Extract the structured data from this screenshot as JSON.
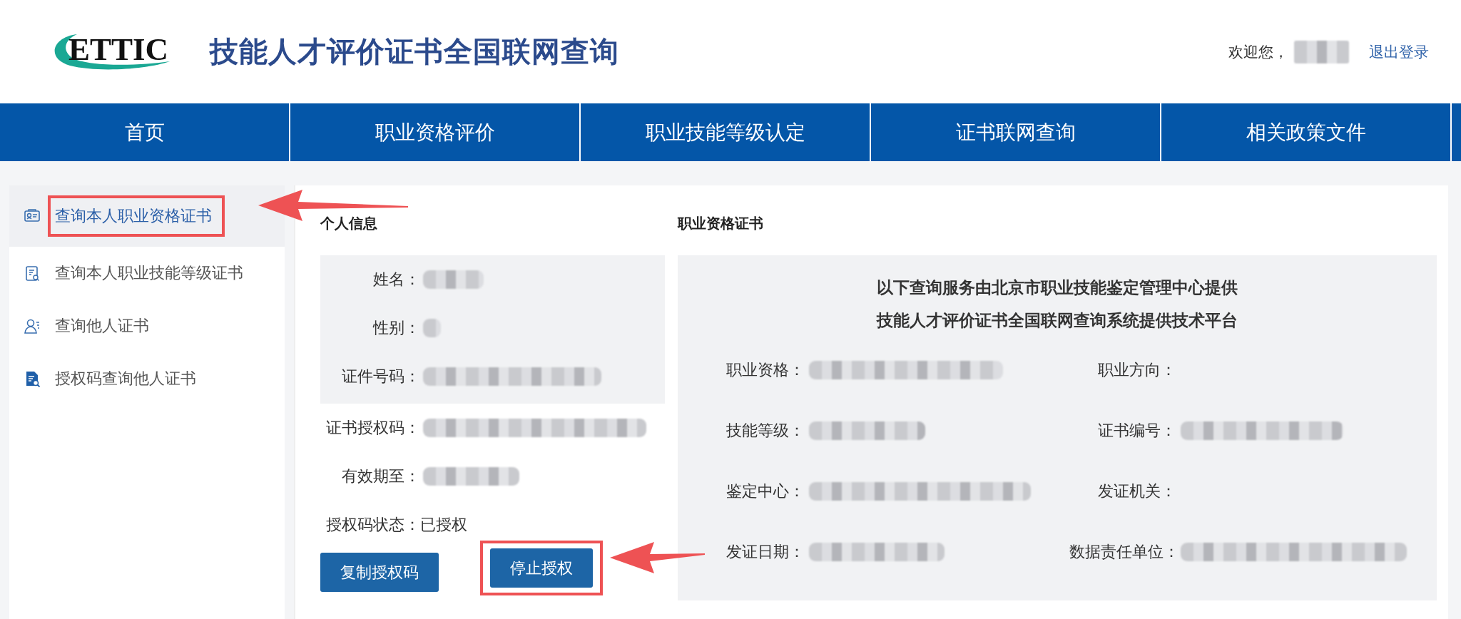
{
  "header": {
    "logo_text": "ETTIC",
    "title": "技能人才评价证书全国联网查询",
    "welcome": "欢迎您，",
    "user_redacted": true,
    "logout": "退出登录"
  },
  "nav": [
    {
      "label": "首页"
    },
    {
      "label": "职业资格评价"
    },
    {
      "label": "职业技能等级认定"
    },
    {
      "label": "证书联网查询"
    },
    {
      "label": "相关政策文件"
    }
  ],
  "sidebar": {
    "items": [
      {
        "label": "查询本人职业资格证书",
        "selected": true,
        "annotated": true
      },
      {
        "label": "查询本人职业技能等级证书",
        "selected": false,
        "annotated": false
      },
      {
        "label": "查询他人证书",
        "selected": false,
        "annotated": false
      },
      {
        "label": "授权码查询他人证书",
        "selected": false,
        "annotated": false
      }
    ]
  },
  "personal": {
    "heading": "个人信息",
    "boxed_fields": [
      {
        "label": "姓名：",
        "redacted": true
      },
      {
        "label": "性别：",
        "redacted": true
      },
      {
        "label": "证件号码：",
        "redacted": true
      }
    ],
    "fields": [
      {
        "label": "证书授权码：",
        "redacted": true
      },
      {
        "label": "有效期至：",
        "redacted": true
      },
      {
        "label": "授权码状态：",
        "value": "已授权",
        "redacted": false
      }
    ],
    "buttons": [
      {
        "label": "复制授权码",
        "annotated": false
      },
      {
        "label": "停止授权",
        "annotated": true
      }
    ]
  },
  "certificate": {
    "heading": "职业资格证书",
    "notice": [
      "以下查询服务由北京市职业技能鉴定管理中心提供",
      "技能人才评价证书全国联网查询系统提供技术平台"
    ],
    "fields": [
      {
        "label": "职业资格：",
        "redacted": true
      },
      {
        "label": "职业方向：",
        "redacted": false
      },
      {
        "label": "技能等级：",
        "redacted": true
      },
      {
        "label": "证书编号：",
        "redacted": true
      },
      {
        "label": "鉴定中心：",
        "redacted": true
      },
      {
        "label": "发证机关：",
        "redacted": false
      },
      {
        "label": "发证日期：",
        "redacted": true
      },
      {
        "label": "数据责任单位：",
        "redacted": true
      }
    ]
  }
}
